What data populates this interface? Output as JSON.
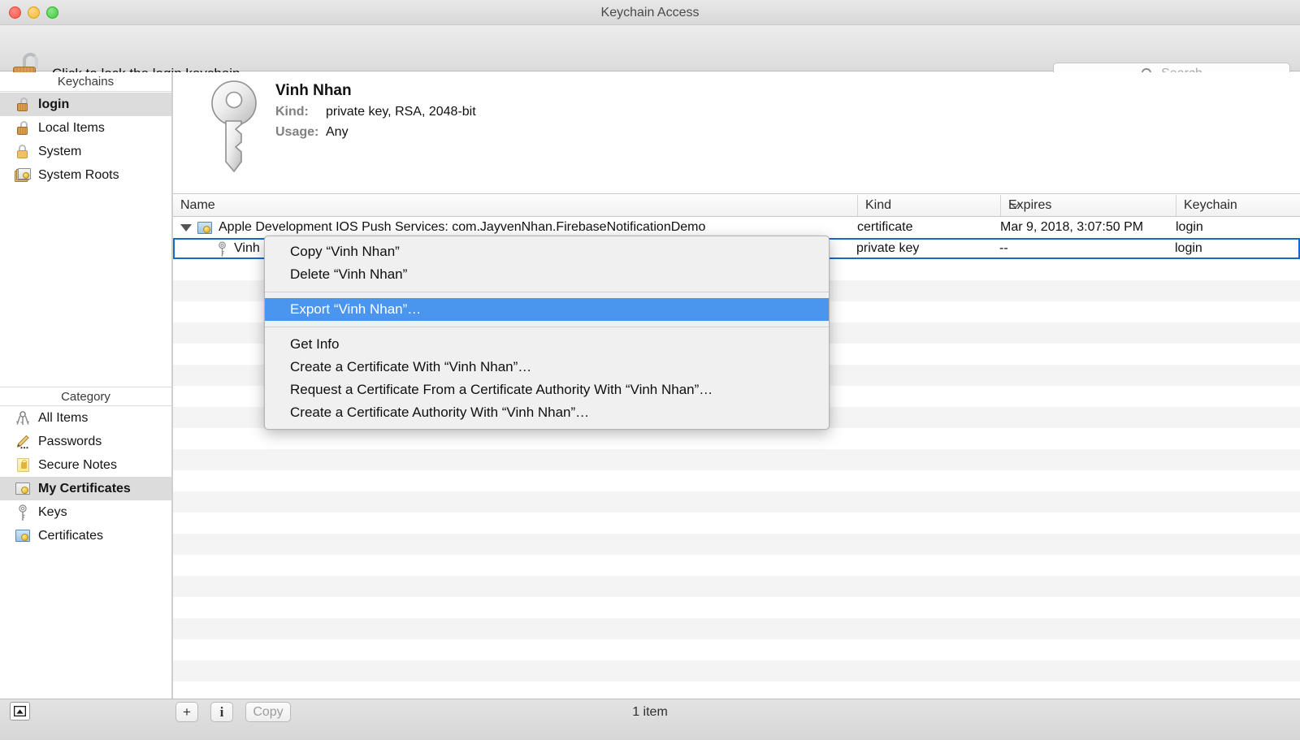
{
  "window": {
    "title": "Keychain Access",
    "traffic_lights": [
      "close-button",
      "minimize-button",
      "maximize-button"
    ]
  },
  "toolbar": {
    "lock_icon": "unlocked-padlock-icon",
    "lock_label": "Click to lock the login keychain.",
    "search": {
      "icon": "search-icon",
      "placeholder": "Search",
      "value": ""
    }
  },
  "sidebar": {
    "keychains_header": "Keychains",
    "keychains": [
      {
        "label": "login",
        "icon": "unlocked-padlock-icon",
        "selected": true
      },
      {
        "label": "Local Items",
        "icon": "unlocked-padlock-icon",
        "selected": false
      },
      {
        "label": "System",
        "icon": "locked-padlock-icon",
        "selected": false
      },
      {
        "label": "System Roots",
        "icon": "certificate-stack-icon",
        "selected": false
      }
    ],
    "category_header": "Category",
    "categories": [
      {
        "label": "All Items",
        "icon": "keyring-icon",
        "selected": false
      },
      {
        "label": "Passwords",
        "icon": "pencil-dots-icon",
        "selected": false
      },
      {
        "label": "Secure Notes",
        "icon": "yellow-note-lock-icon",
        "selected": false
      },
      {
        "label": "My Certificates",
        "icon": "certificate-key-icon",
        "selected": true
      },
      {
        "label": "Keys",
        "icon": "key-icon",
        "selected": false
      },
      {
        "label": "Certificates",
        "icon": "certificate-blue-icon",
        "selected": false
      }
    ]
  },
  "detail": {
    "icon": "large-key-icon",
    "title": "Vinh Nhan",
    "fields": [
      {
        "key": "Kind:",
        "value": "private key, RSA, 2048-bit"
      },
      {
        "key": "Usage:",
        "value": "Any"
      }
    ]
  },
  "table": {
    "columns": [
      {
        "label": "Name",
        "sorted": true,
        "sort_icon": "chevron-down-icon"
      },
      {
        "label": "Kind",
        "sorted": false
      },
      {
        "label": "Expires",
        "sorted": false
      },
      {
        "label": "Keychain",
        "sorted": false
      }
    ],
    "rows": [
      {
        "name": "Apple Development IOS Push Services: com.JayvenNhan.FirebaseNotificationDemo",
        "kind": "certificate",
        "expires": "Mar 9, 2018, 3:07:50 PM",
        "keychain": "login",
        "icon": "certificate-icon",
        "expanded": true,
        "child": false,
        "selected": false
      },
      {
        "name": "Vinh Nhan",
        "kind": "private key",
        "expires": "--",
        "keychain": "login",
        "icon": "key-icon",
        "expanded": false,
        "child": true,
        "selected": true
      }
    ]
  },
  "context_menu": {
    "groups": [
      {
        "items": [
          {
            "label": "Copy “Vinh Nhan”",
            "highlighted": false
          },
          {
            "label": "Delete “Vinh Nhan”",
            "highlighted": false
          }
        ]
      },
      {
        "items": [
          {
            "label": "Export “Vinh Nhan”…",
            "highlighted": true
          }
        ]
      },
      {
        "items": [
          {
            "label": "Get Info",
            "highlighted": false
          },
          {
            "label": "Create a Certificate With “Vinh Nhan”…",
            "highlighted": false
          },
          {
            "label": "Request a Certificate From a Certificate Authority With “Vinh Nhan”…",
            "highlighted": false
          },
          {
            "label": "Create a Certificate Authority With “Vinh Nhan”…",
            "highlighted": false
          }
        ]
      }
    ],
    "highlight_color": "#4a96ef"
  },
  "bottom_bar": {
    "show_keychains_icon": "show-keychains-icon",
    "add_label": "+",
    "info_label": "i",
    "copy_label": "Copy",
    "copy_disabled": true,
    "status": "1 item"
  },
  "colors": {
    "selection_border": "#1868d0",
    "menu_highlight": "#4a96ef",
    "sidebar_selected": "#dcdcdc",
    "row_alt": "#f4f4f4"
  }
}
